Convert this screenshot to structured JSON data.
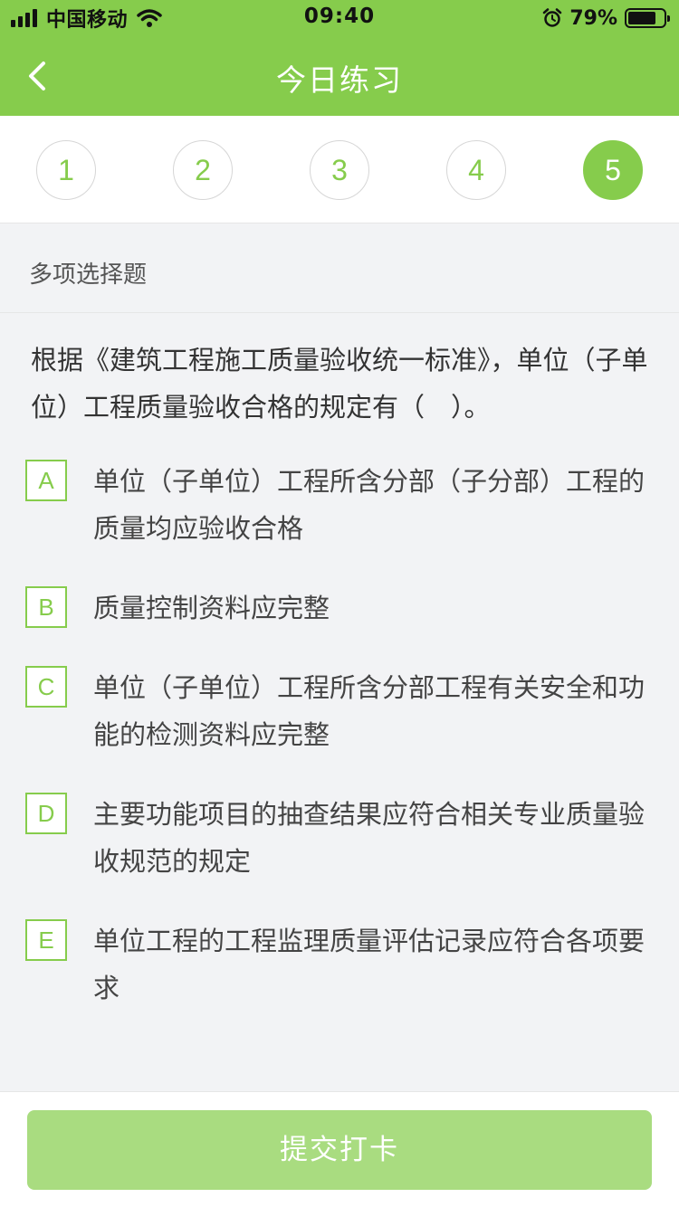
{
  "status_bar": {
    "carrier": "中国移动",
    "time": "09:40",
    "battery_percent": "79%",
    "battery_level": 0.79
  },
  "nav": {
    "title": "今日练习",
    "back_icon": "chevron-left-icon"
  },
  "steps": [
    {
      "label": "1",
      "active": false
    },
    {
      "label": "2",
      "active": false
    },
    {
      "label": "3",
      "active": false
    },
    {
      "label": "4",
      "active": false
    },
    {
      "label": "5",
      "active": true
    }
  ],
  "question": {
    "type": "多项选择题",
    "text": "根据《建筑工程施工质量验收统一标准》，单位（子单位）工程质量验收合格的规定有（　）。",
    "options": [
      {
        "key": "A",
        "text": "单位（子单位）工程所含分部（子分部）工程的质量均应验收合格"
      },
      {
        "key": "B",
        "text": "质量控制资料应完整"
      },
      {
        "key": "C",
        "text": "单位（子单位）工程所含分部工程有关安全和功能的检测资料应完整"
      },
      {
        "key": "D",
        "text": "主要功能项目的抽查结果应符合相关专业质量验收规范的规定"
      },
      {
        "key": "E",
        "text": "单位工程的工程监理质量评估记录应符合各项要求"
      }
    ]
  },
  "submit_label": "提交打卡",
  "colors": {
    "accent": "#86cc4c",
    "submit_disabled": "#a9dc80",
    "background": "#f2f3f5"
  }
}
